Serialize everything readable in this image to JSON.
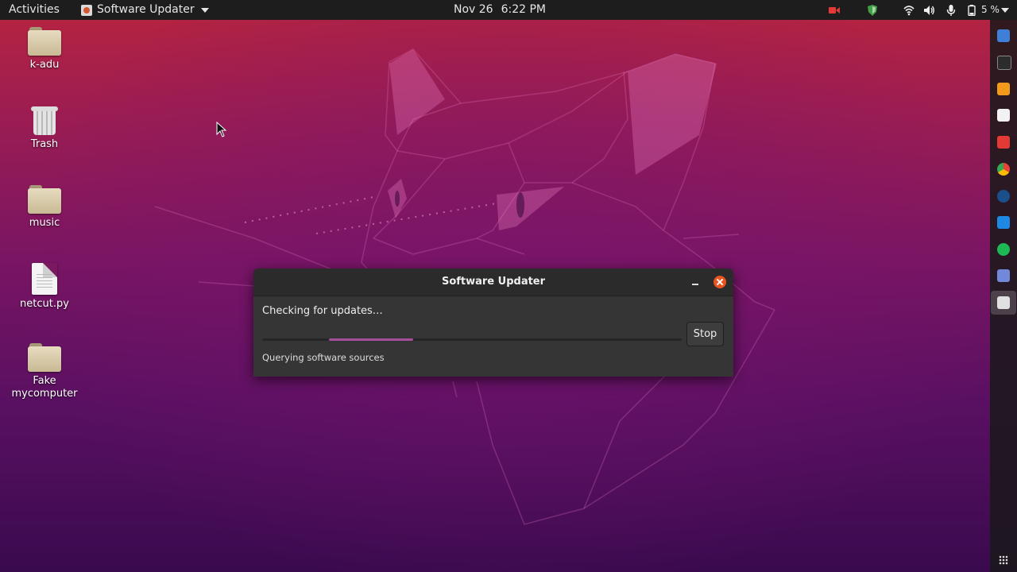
{
  "topbar": {
    "activities": "Activities",
    "app_menu": "Software Updater",
    "date": "Nov 26",
    "time": "6:22 PM",
    "battery": "5 %"
  },
  "desktop": {
    "icons": [
      {
        "label": "k-adu",
        "icon": "home-folder-icon"
      },
      {
        "label": "Trash",
        "icon": "trash-icon"
      },
      {
        "label": "music",
        "icon": "folder-icon"
      },
      {
        "label": "netcut.py",
        "icon": "text-file-icon"
      },
      {
        "label": "Fake\nmycomputer",
        "icon": "folder-icon"
      }
    ]
  },
  "dialog": {
    "title": "Software Updater",
    "heading": "Checking for updates…",
    "stop_label": "Stop",
    "detail": "Querying software sources"
  },
  "dock": {
    "items": [
      "libreoffice-writer-icon",
      "terminal-icon",
      "sublime-text-icon",
      "ubuntu-software-icon",
      "anydesk-icon",
      "chrome-icon",
      "steam-icon",
      "vscode-icon",
      "spotify-icon",
      "discord-icon",
      "software-updater-icon"
    ],
    "active": "software-updater-icon"
  },
  "colors": {
    "accent": "#e95420",
    "progress": "#a54f9a",
    "panel": "#1d1d1d"
  }
}
